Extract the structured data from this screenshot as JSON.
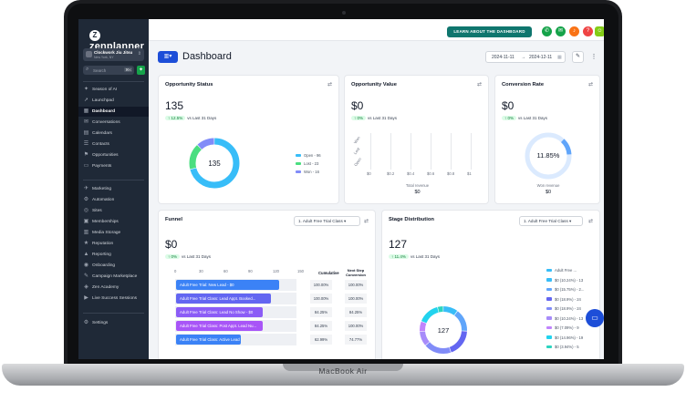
{
  "device": {
    "label": "MacBook Air"
  },
  "sidebar": {
    "logo": "zenplanner",
    "logo_mark": "Z",
    "account": {
      "name": "Clockwork Jiu Jitsu",
      "location": "New York, NY"
    },
    "search": {
      "placeholder": "Search",
      "shortcut": "⌘K"
    },
    "items": [
      {
        "label": "Season of AI",
        "icon": "sparkle-icon"
      },
      {
        "label": "Launchpad",
        "icon": "rocket-icon"
      },
      {
        "label": "Dashboard",
        "icon": "dashboard-icon",
        "active": true
      },
      {
        "label": "Conversations",
        "icon": "chat-icon"
      },
      {
        "label": "Calendars",
        "icon": "calendar-icon"
      },
      {
        "label": "Contacts",
        "icon": "contacts-icon"
      },
      {
        "label": "Opportunities",
        "icon": "opportunities-icon"
      },
      {
        "label": "Payments",
        "icon": "payments-icon"
      },
      {
        "label": "Marketing",
        "icon": "marketing-icon"
      },
      {
        "label": "Automation",
        "icon": "automation-icon"
      },
      {
        "label": "Sites",
        "icon": "sites-icon"
      },
      {
        "label": "Memberships",
        "icon": "memberships-icon"
      },
      {
        "label": "Media Storage",
        "icon": "media-icon"
      },
      {
        "label": "Reputation",
        "icon": "reputation-icon"
      },
      {
        "label": "Reporting",
        "icon": "reporting-icon"
      },
      {
        "label": "Onboarding",
        "icon": "onboarding-icon"
      },
      {
        "label": "Campaign Marketplace",
        "icon": "marketplace-icon"
      },
      {
        "label": "Zen Academy",
        "icon": "academy-icon"
      },
      {
        "label": "Live Success Sessions",
        "icon": "live-icon"
      },
      {
        "label": "Settings",
        "icon": "settings-icon"
      }
    ]
  },
  "topbar": {
    "learn_label": "LEARN ABOUT THE DASHBOARD",
    "icon_colors": [
      "#16a34a",
      "#16a34a",
      "#f97316",
      "#ef4444",
      "#84cc16"
    ]
  },
  "header": {
    "title": "Dashboard",
    "date_start": "2024-11-11",
    "date_arrow": "→",
    "date_end": "2024-12-11"
  },
  "opportunity_status": {
    "title": "Opportunity Status",
    "value": "135",
    "delta": "↑ 12.5%",
    "delta_suffix": "vs Last 31 Days",
    "donut_center": "135",
    "legend": [
      {
        "label": "Open - 96",
        "color": "#38bdf8",
        "value": 96
      },
      {
        "label": "Lost - 23",
        "color": "#4ade80",
        "value": 23
      },
      {
        "label": "Won - 16",
        "color": "#818cf8",
        "value": 16
      }
    ]
  },
  "opportunity_value": {
    "title": "Opportunity Value",
    "value": "$0",
    "delta": "↑ 0%",
    "delta_suffix": "vs Last 31 Days",
    "y_labels": [
      "Won",
      "Lost",
      "Open"
    ],
    "x_labels": [
      "$0",
      "$0.2",
      "$0.4",
      "$0.6",
      "$0.8",
      "$1"
    ],
    "footer_label": "Total revenue",
    "footer_value": "$0"
  },
  "conversion_rate": {
    "title": "Conversion Rate",
    "value": "$0",
    "delta": "↑ 0%",
    "delta_suffix": "vs Last 31 Days",
    "gauge_value": "11.85%",
    "gauge_fraction": 0.1185,
    "footer_label": "Won revenue",
    "footer_value": "$0"
  },
  "funnel": {
    "title": "Funnel",
    "dropdown": "1. Adult Free Trial Class",
    "value": "$0",
    "delta": "↑ 0%",
    "delta_suffix": "vs Last 31 Days",
    "ticks": [
      "0",
      "30",
      "60",
      "90",
      "120",
      "150"
    ],
    "col_cumulative": "Cumulative",
    "col_next_1": "Next Step",
    "col_next_2": "Conversion",
    "rows": [
      {
        "label": "Adult Free Trial: New Lead - $0",
        "color": "#3b82f6",
        "fraction": 1.0,
        "cumulative": "100.00%",
        "next": "100.00%"
      },
      {
        "label": "Adult Free Trial Class: Lead Appt. Booked...",
        "color": "#6366f1",
        "fraction": 0.92,
        "cumulative": "100.00%",
        "next": "100.00%"
      },
      {
        "label": "Adult Free Trial Class: Lead No Show - $0",
        "color": "#8b5cf6",
        "fraction": 0.84,
        "cumulative": "84.25%",
        "next": "84.25%"
      },
      {
        "label": "Adult Free Trial Class: Post Appt. Lead Nu...",
        "color": "#a855f7",
        "fraction": 0.84,
        "cumulative": "84.25%",
        "next": "100.00%"
      },
      {
        "label": "Adult Free Trial Class: Active Lead - $0",
        "color": "#3b82f6",
        "fraction": 0.63,
        "cumulative": "62.99%",
        "next": "74.77%"
      }
    ]
  },
  "stage_distribution": {
    "title": "Stage Distribution",
    "dropdown": "1. Adult Free Trial Class",
    "value": "127",
    "delta": "↑ 11.4%",
    "delta_suffix": "vs Last 31 Days",
    "donut_center": "127",
    "legend": [
      {
        "label": "Adult Free ...",
        "color": "#38bdf8"
      },
      {
        "label": "$0 (10.24%) - 13",
        "color": "#38bdf8"
      },
      {
        "label": "$0 (15.75%) - 2...",
        "color": "#60a5fa"
      },
      {
        "label": "$0 (18.9%) - 24",
        "color": "#6366f1"
      },
      {
        "label": "$0 (18.9%) - 24",
        "color": "#818cf8"
      },
      {
        "label": "$0 (10.24%) - 13",
        "color": "#a78bfa"
      },
      {
        "label": "$0 (7.09%) - 9",
        "color": "#c084fc"
      },
      {
        "label": "$0 (14.96%) - 19",
        "color": "#22d3ee"
      },
      {
        "label": "$0 (3.94%) - 5",
        "color": "#2dd4bf"
      }
    ],
    "slices": [
      {
        "value": 13,
        "color": "#38bdf8"
      },
      {
        "value": 20,
        "color": "#60a5fa"
      },
      {
        "value": 24,
        "color": "#6366f1"
      },
      {
        "value": 24,
        "color": "#818cf8"
      },
      {
        "value": 13,
        "color": "#a78bfa"
      },
      {
        "value": 9,
        "color": "#c084fc"
      },
      {
        "value": 19,
        "color": "#22d3ee"
      },
      {
        "value": 5,
        "color": "#2dd4bf"
      }
    ]
  }
}
